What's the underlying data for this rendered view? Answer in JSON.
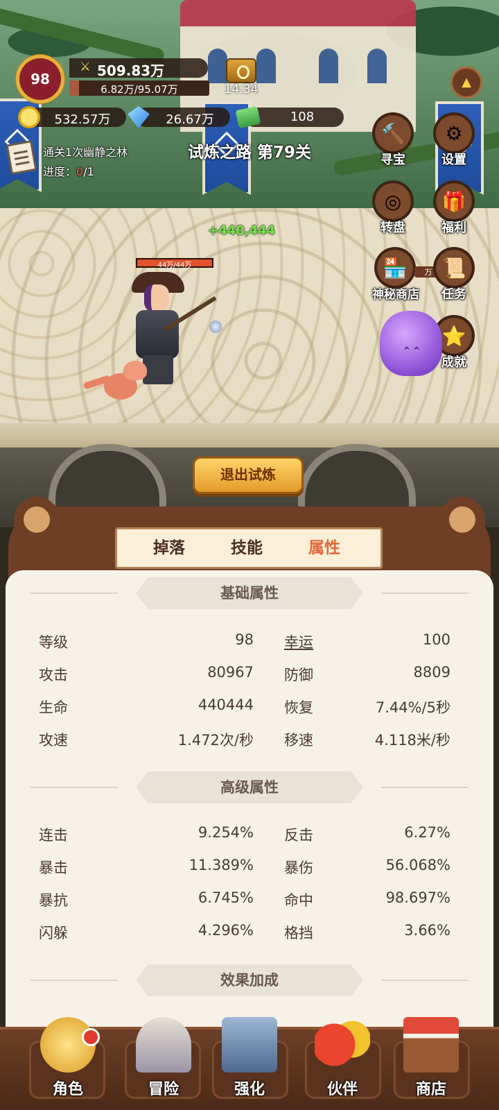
{
  "hud": {
    "level": "98",
    "power": "509.83万",
    "exp_text": "6.82万/95.07万",
    "exp_fraction": 0.0717,
    "timer": "14:34",
    "gold": "532.57万",
    "gems": "26.67万",
    "cash": "108"
  },
  "quest": {
    "title": "通关1次幽静之林",
    "progress_label": "进度：",
    "progress_current": "0",
    "progress_total": "/1"
  },
  "stage": {
    "title": "试炼之路 第79关",
    "heal_float": "+440,444"
  },
  "hero": {
    "hp_text": "44万/44万",
    "hp_fraction": 1.0
  },
  "side_buttons": {
    "treasure": "寻宝",
    "settings": "设置",
    "wheel": "转盘",
    "welfare": "福利",
    "mystery_shop": "神秘商店",
    "mystery_shop_price": "万",
    "tasks": "任务",
    "achievements": "成就"
  },
  "exit_button": "退出试炼",
  "tabs": {
    "drop": "掉落",
    "skill": "技能",
    "attr": "属性"
  },
  "sections": {
    "basic": "基础属性",
    "advanced": "高级属性",
    "bonus": "效果加成"
  },
  "basic_stats": [
    {
      "k1": "等级",
      "v1": "98",
      "k2": "幸运",
      "v2": "100"
    },
    {
      "k1": "攻击",
      "v1": "80967",
      "k2": "防御",
      "v2": "8809"
    },
    {
      "k1": "生命",
      "v1": "440444",
      "k2": "恢复",
      "v2": "7.44%/5秒"
    },
    {
      "k1": "攻速",
      "v1": "1.472次/秒",
      "k2": "移速",
      "v2": "4.118米/秒"
    }
  ],
  "advanced_stats": [
    {
      "k1": "连击",
      "v1": "9.254%",
      "k2": "反击",
      "v2": "6.27%"
    },
    {
      "k1": "暴击",
      "v1": "11.389%",
      "k2": "暴伤",
      "v2": "56.068%"
    },
    {
      "k1": "暴抗",
      "v1": "6.745%",
      "k2": "命中",
      "v2": "98.697%"
    },
    {
      "k1": "闪躲",
      "v1": "4.296%",
      "k2": "格挡",
      "v2": "3.66%"
    }
  ],
  "nav": {
    "role": "角色",
    "adventure": "冒险",
    "enhance": "强化",
    "partner": "伙伴",
    "shop": "商店"
  },
  "colors": {
    "active_tab": "#e2673a",
    "heal": "#7be04d",
    "progress_current": "#ff5a4f"
  }
}
